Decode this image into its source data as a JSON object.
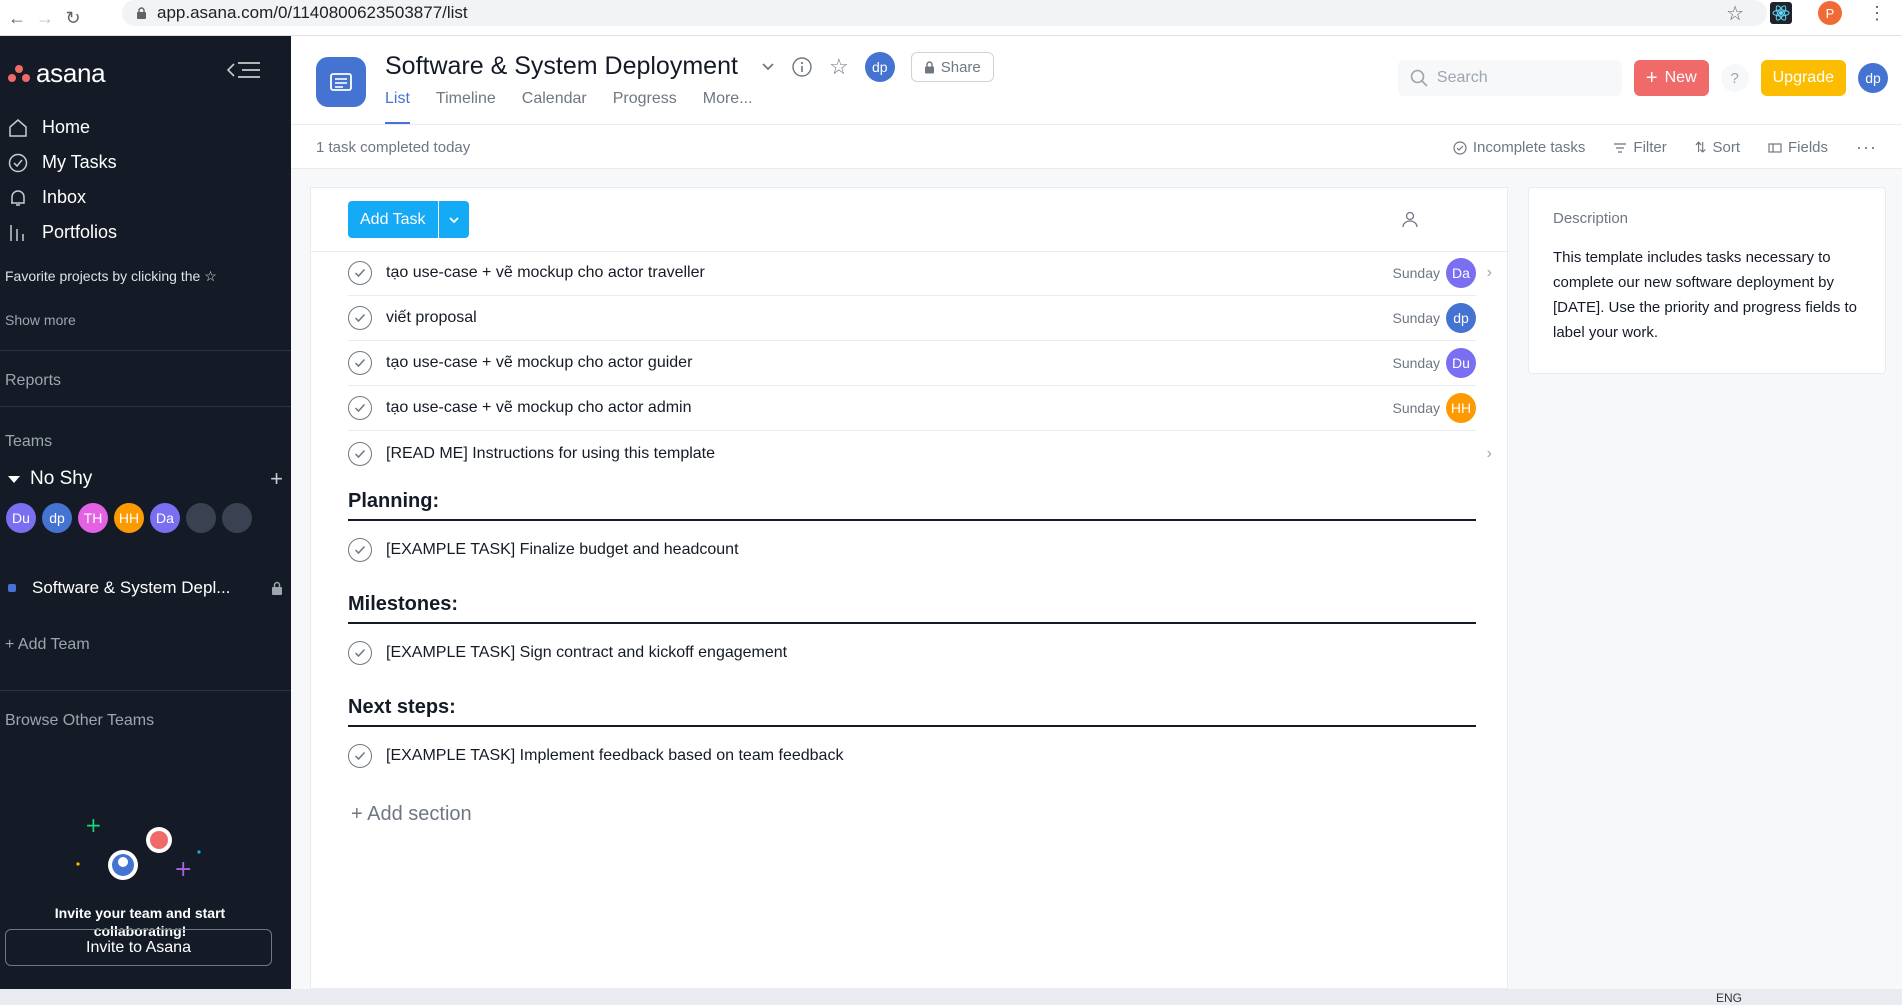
{
  "browser": {
    "url": "app.asana.com/0/1140800623503877/list",
    "profile_initial": "P"
  },
  "sidebar": {
    "logo_text": "asana",
    "nav": [
      {
        "label": "Home",
        "icon": "home-icon"
      },
      {
        "label": "My Tasks",
        "icon": "check-circle-icon"
      },
      {
        "label": "Inbox",
        "icon": "bell-icon"
      },
      {
        "label": "Portfolios",
        "icon": "bar-chart-icon"
      }
    ],
    "favorites_hint": "Favorite projects by clicking the",
    "show_more": "Show more",
    "reports": "Reports",
    "teams": "Teams",
    "team_name": "No Shy",
    "members": [
      {
        "initials": "Du",
        "color": "#7a6ff0"
      },
      {
        "initials": "dp",
        "color": "#4573d2"
      },
      {
        "initials": "TH",
        "color": "#e362e3"
      },
      {
        "initials": "HH",
        "color": "#fd9a00"
      },
      {
        "initials": "Da",
        "color": "#7a6ff0"
      },
      {
        "initials": "",
        "color": "#3a4150"
      },
      {
        "initials": "",
        "color": "#3a4150"
      }
    ],
    "project_name": "Software & System Depl...",
    "add_team": "Add Team",
    "browse_teams": "Browse Other Teams",
    "invite_text": "Invite your team and start collaborating!",
    "invite_button": "Invite to Asana"
  },
  "header": {
    "project_title": "Software & System Deployment",
    "owner_initials": "dp",
    "share_label": "Share",
    "tabs": [
      "List",
      "Timeline",
      "Calendar",
      "Progress",
      "More..."
    ],
    "search_placeholder": "Search",
    "new_label": "New",
    "help_label": "?",
    "upgrade_label": "Upgrade",
    "user_initials": "dp"
  },
  "subbar": {
    "status": "1 task completed today",
    "incomplete": "Incomplete tasks",
    "filter": "Filter",
    "sort": "Sort",
    "fields": "Fields",
    "more": "···"
  },
  "list": {
    "add_task": "Add Task",
    "tasks": [
      {
        "name": "tạo use-case + vẽ mockup cho actor traveller",
        "due": "Sunday",
        "assignee": "Da",
        "color": "#7a6ff0",
        "chevron": true
      },
      {
        "name": "viết proposal",
        "due": "Sunday",
        "assignee": "dp",
        "color": "#4573d2",
        "chevron": false
      },
      {
        "name": "tạo use-case + vẽ mockup cho actor guider",
        "due": "Sunday",
        "assignee": "Du",
        "color": "#7a6ff0",
        "chevron": false
      },
      {
        "name": "tạo use-case + vẽ mockup cho actor admin",
        "due": "Sunday",
        "assignee": "HH",
        "color": "#fd9a00",
        "chevron": false
      },
      {
        "name": "[READ ME] Instructions for using this template",
        "due": "",
        "assignee": "",
        "color": "",
        "chevron": true
      }
    ],
    "sections": [
      {
        "title": "Planning:",
        "task": "[EXAMPLE TASK] Finalize budget and headcount"
      },
      {
        "title": "Milestones:",
        "task": "[EXAMPLE TASK] Sign contract and kickoff engagement"
      },
      {
        "title": "Next steps:",
        "task": "[EXAMPLE TASK] Implement feedback based on team feedback"
      }
    ],
    "add_section": "+ Add section"
  },
  "description": {
    "heading": "Description",
    "body": "This template includes tasks necessary to complete our new software deployment by [DATE]. Use the priority and progress fields to label your work."
  },
  "taskbar": {
    "lang": "ENG"
  }
}
